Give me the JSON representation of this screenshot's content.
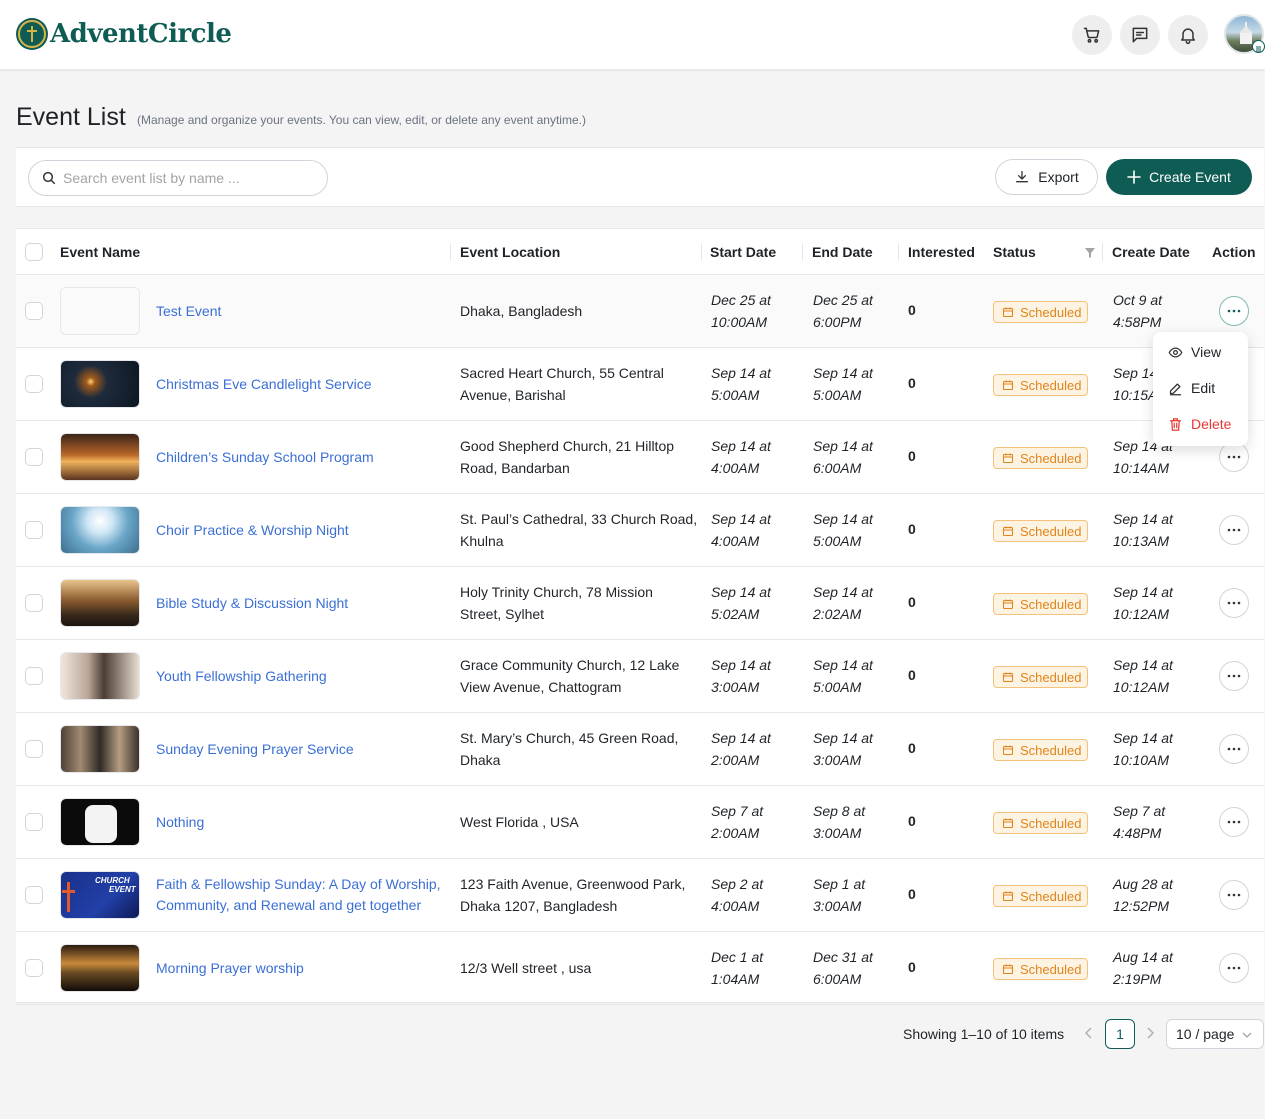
{
  "brand": {
    "name": "AdventCircle"
  },
  "header": {
    "icons": [
      "cart-icon",
      "message-icon",
      "bell-icon"
    ],
    "avatar": "user-avatar"
  },
  "page": {
    "title": "Event List",
    "subtitle": "(Manage and organize your events. You can view, edit, or delete any event anytime.)"
  },
  "toolbar": {
    "search_placeholder": "Search event list by name ...",
    "export_label": "Export",
    "create_label": "Create Event"
  },
  "table": {
    "columns": [
      "Event Name",
      "Event Location",
      "Start Date",
      "End Date",
      "Interested",
      "Status",
      "Create Date",
      "Action"
    ],
    "rows": [
      {
        "name": "Test Event",
        "location": "Dhaka, Bangladesh",
        "start": "Dec 25 at 10:00AM",
        "start1": "Dec 25 at",
        "start2": "10:00AM",
        "end1": "Dec 25 at",
        "end2": "6:00PM",
        "interested": "0",
        "status": "Scheduled",
        "create1": "Oct 9 at",
        "create2": "4:58PM",
        "thumb": "blank"
      },
      {
        "name": "Christmas Eve Candlelight Service",
        "location": "Sacred Heart Church, 55 Central Avenue, Barishal",
        "start1": "Sep 14 at",
        "start2": "5:00AM",
        "end1": "Sep 14 at",
        "end2": "5:00AM",
        "interested": "0",
        "status": "Scheduled",
        "create1": "Sep 14",
        "create2": "10:15A",
        "thumb": "candles"
      },
      {
        "name": "Children’s Sunday School Program",
        "location": "Good Shepherd Church, 21 Hilltop Road, Bandarban",
        "start1": "Sep 14 at",
        "start2": "4:00AM",
        "end1": "Sep 14 at",
        "end2": "6:00AM",
        "interested": "0",
        "status": "Scheduled",
        "create1": "Sep 14 at",
        "create2": "10:14AM",
        "thumb": "church-interior"
      },
      {
        "name": "Choir Practice & Worship Night",
        "location": "St. Paul’s Cathedral, 33 Church Road, Khulna",
        "start1": "Sep 14 at",
        "start2": "4:00AM",
        "end1": "Sep 14 at",
        "end2": "5:00AM",
        "interested": "0",
        "status": "Scheduled",
        "create1": "Sep 14 at",
        "create2": "10:13AM",
        "thumb": "dove-sky"
      },
      {
        "name": "Bible Study & Discussion Night",
        "location": "Holy Trinity Church, 78 Mission Street, Sylhet",
        "start1": "Sep 14 at",
        "start2": "5:02AM",
        "end1": "Sep 14 at",
        "end2": "2:02AM",
        "interested": "0",
        "status": "Scheduled",
        "create1": "Sep 14 at",
        "create2": "10:12AM",
        "thumb": "crowd-bridge"
      },
      {
        "name": "Youth Fellowship Gathering",
        "location": "Grace Community Church, 12 Lake View Avenue, Chattogram",
        "start1": "Sep 14 at",
        "start2": "3:00AM",
        "end1": "Sep 14 at",
        "end2": "5:00AM",
        "interested": "0",
        "status": "Scheduled",
        "create1": "Sep 14 at",
        "create2": "10:12AM",
        "thumb": "people-praying"
      },
      {
        "name": "Sunday Evening Prayer Service",
        "location": "St. Mary’s Church, 45 Green Road, Dhaka",
        "start1": "Sep 14 at",
        "start2": "2:00AM",
        "end1": "Sep 14 at",
        "end2": "3:00AM",
        "interested": "0",
        "status": "Scheduled",
        "create1": "Sep 14 at",
        "create2": "10:10AM",
        "thumb": "collage"
      },
      {
        "name": "Nothing",
        "location": "West Florida , USA",
        "start1": "Sep 7 at",
        "start2": "2:00AM",
        "end1": "Sep 8 at",
        "end2": "3:00AM",
        "interested": "0",
        "status": "Scheduled",
        "create1": "Sep 7 at",
        "create2": "4:48PM",
        "thumb": "earbuds"
      },
      {
        "name": "Faith & Fellowship Sunday: A Day of Worship, Community, and Renewal and get together",
        "location": "123 Faith Avenue, Greenwood Park, Dhaka 1207, Bangladesh",
        "start1": "Sep 2 at",
        "start2": "4:00AM",
        "end1": "Sep 1 at",
        "end2": "3:00AM",
        "interested": "0",
        "status": "Scheduled",
        "create1": "Aug 28 at",
        "create2": "12:52PM",
        "thumb": "church-event",
        "thumb_text1": "CHURCH",
        "thumb_text2": "EVENT"
      },
      {
        "name": "Morning Prayer worship",
        "location": "12/3 Well street , usa",
        "start1": "Dec 1 at",
        "start2": "1:04AM",
        "end1": "Dec 31 at",
        "end2": "6:00AM",
        "interested": "0",
        "status": "Scheduled",
        "create1": "Aug 14 at",
        "create2": "2:19PM",
        "thumb": "sunset-water"
      }
    ]
  },
  "menu": {
    "view_label": "View",
    "edit_label": "Edit",
    "delete_label": "Delete"
  },
  "pagination": {
    "summary": "Showing 1–10 of 10 items",
    "current_page": "1",
    "page_size": "10 / page"
  },
  "colors": {
    "brand": "#0f5c55",
    "link": "#3b6fd6",
    "status_text": "#e0851a",
    "status_bg": "#fdf3e3",
    "delete": "#e53935"
  }
}
